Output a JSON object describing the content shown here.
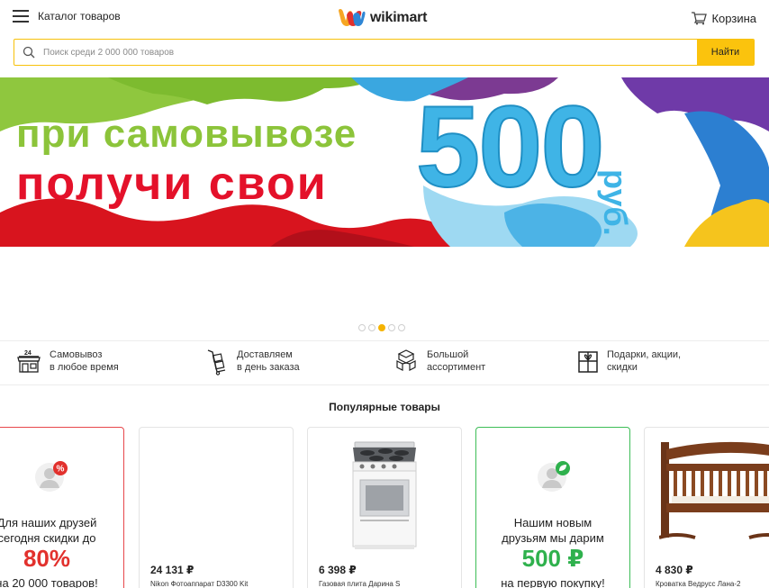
{
  "header": {
    "catalog_label": "Каталог товаров",
    "logo_text": "wikimart",
    "cart_label": "Корзина"
  },
  "search": {
    "placeholder": "Поиск среди 2 000 000 товаров",
    "button_label": "Найти"
  },
  "banner": {
    "line1": "при самовывозе",
    "line2": "получи свои",
    "amount": "500",
    "currency": "руб."
  },
  "carousel": {
    "total_slides": 5,
    "active_slide": 3
  },
  "features": [
    {
      "icon": "store-24-icon",
      "line1": "Самовывоз",
      "line2": "в любое время"
    },
    {
      "icon": "delivery-cart-icon",
      "line1": "Доставляем",
      "line2": "в день заказа"
    },
    {
      "icon": "boxes-icon",
      "line1": "Большой",
      "line2": "ассортимент"
    },
    {
      "icon": "gift-icon",
      "line1": "Подарки, акции,",
      "line2": "скидки"
    }
  ],
  "popular": {
    "title": "Популярные товары",
    "friends_promo": {
      "line1": "Для наших друзей",
      "line2": "сегодня скидки до",
      "discount": "80%",
      "line3": "на 20 000 товаров!",
      "badge": "%"
    },
    "products": [
      {
        "price": "24 131 ₽",
        "name": "Nikon Фотоаппарат D3300 Kit"
      },
      {
        "price": "6 398 ₽",
        "name": "Газовая плита Дарина S"
      },
      {
        "price": "4 830 ₽",
        "name": "Кроватка Ведрусс Лана-2"
      }
    ],
    "new_friends_promo": {
      "line1": "Нашим новым",
      "line2": "друзьям мы дарим",
      "amount": "500 ₽",
      "line3": "на первую покупку!"
    }
  },
  "colors": {
    "accent_yellow": "#fbc30d",
    "promo_red": "#e7474b",
    "promo_green": "#3dbd57"
  }
}
